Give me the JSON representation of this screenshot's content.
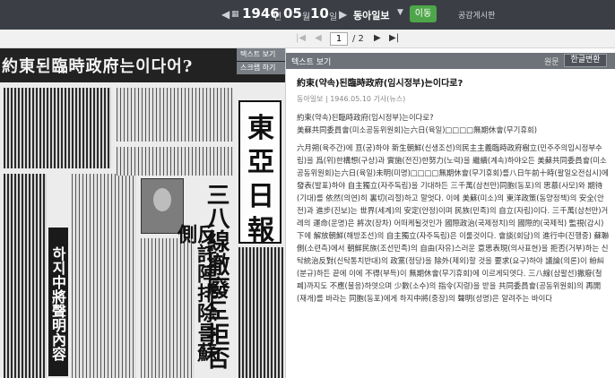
{
  "toolbar": {
    "year": "1946",
    "year_unit": "년",
    "month": "05",
    "month_unit": "월",
    "day": "10",
    "day_unit": "일",
    "newspaper": "동아일보",
    "go_label": "이동",
    "board_link": "공감게시판",
    "prev_day": "◀",
    "next_day": "▶"
  },
  "pager": {
    "first": "|◀",
    "prev": "◀",
    "current_page": "1",
    "total": "/ 2",
    "next": "▶",
    "last": "▶|"
  },
  "scan": {
    "masthead": "約東된臨時政府는이다어?",
    "logo_glyphs": [
      "東",
      "亞",
      "日",
      "報"
    ],
    "headline_1": "三八線撤廢도拒否",
    "headline_2": "反託陣排除를蘇側",
    "invert_headline": "하지中將聲明內容",
    "side_tabs": [
      "텍스트 보기",
      "스크랩 하기"
    ]
  },
  "panel": {
    "title": "텍스트 보기",
    "view_original": "원문",
    "view_korean": "한글변환",
    "article_title": "約束(약속)된臨時政府(임시정부)는이다로?",
    "meta": "동아일보 | 1946.05.10 기사(뉴스)",
    "headline_line_1": "約束(약속)된臨時政府(임시정부)는이다로?",
    "headline_line_2": "美蘇共同委員會(미소공동위원회)는六日(육일)□□□□無期休會(무기휴회)",
    "body": "六月朔(육주간)에 亘(궁)하야 新生朝鮮(신생조선)의民主主義臨時政府樹立(민주주의임시정부수립)을 爲(위)한構想(구상)과 實施(전진)한努力(노력)을 繼續(계속)하야오든 美蘇共同委員會(미소공동위원회)는六日(육일)未明(미명)□□□□無期休會(무기휴회)를八日午前十時(팔일오전십시)에 發表(발표)하야 自主獨立(자주독립)을 기대하든 三千萬(삼천만)同胞(동포)의 思慕(사모)와 期待(기대)를 依然(의연)히 裏切(리절)하고 말엇다. 이에 美蘇(미소)의 東洋政策(동양정책)의 安全(안전)과 進步(진보)는 世界(세계)의 安定(안정)이며 民族(민족)의 自立(자립)이다. 三千萬(삼천만)거레의 運命(운명)은 將次(장차) 어떠케될것인가 國際政治(국제정치)의 國際的(국제적) 監視(감시)下에 解放朝鮮(해방조선)의 自主獨立(자주독립)은 이룰것이다. 會談(회담)의 進行中(진행중) 蘇聯側(소련측)에서 朝鮮民族(조선민족)의 自由(자유)스러운 意思表現(의사표현)을 拒否(거부)하는 신탁統治反對(신탁통치반대)의 政黨(정당)을 除外(제외)할 것을 要求(요구)하야 議論(의론)이 紛糾(분규)하든 끝에 이에 不得(부득)이 無期休會(무기휴회)에 이르게되엿다. 三八線(삼팔선)撤廢(철폐)까지도 不應(불응)하엿으며 少數(소수)의 指令(지령)을 받을 共同委員會(공동위원회)의 再開(재개)를 바라는 同胞(동포)에게 하지中將(중장)의 聲明(성명)은 알려주는 바이다"
  }
}
